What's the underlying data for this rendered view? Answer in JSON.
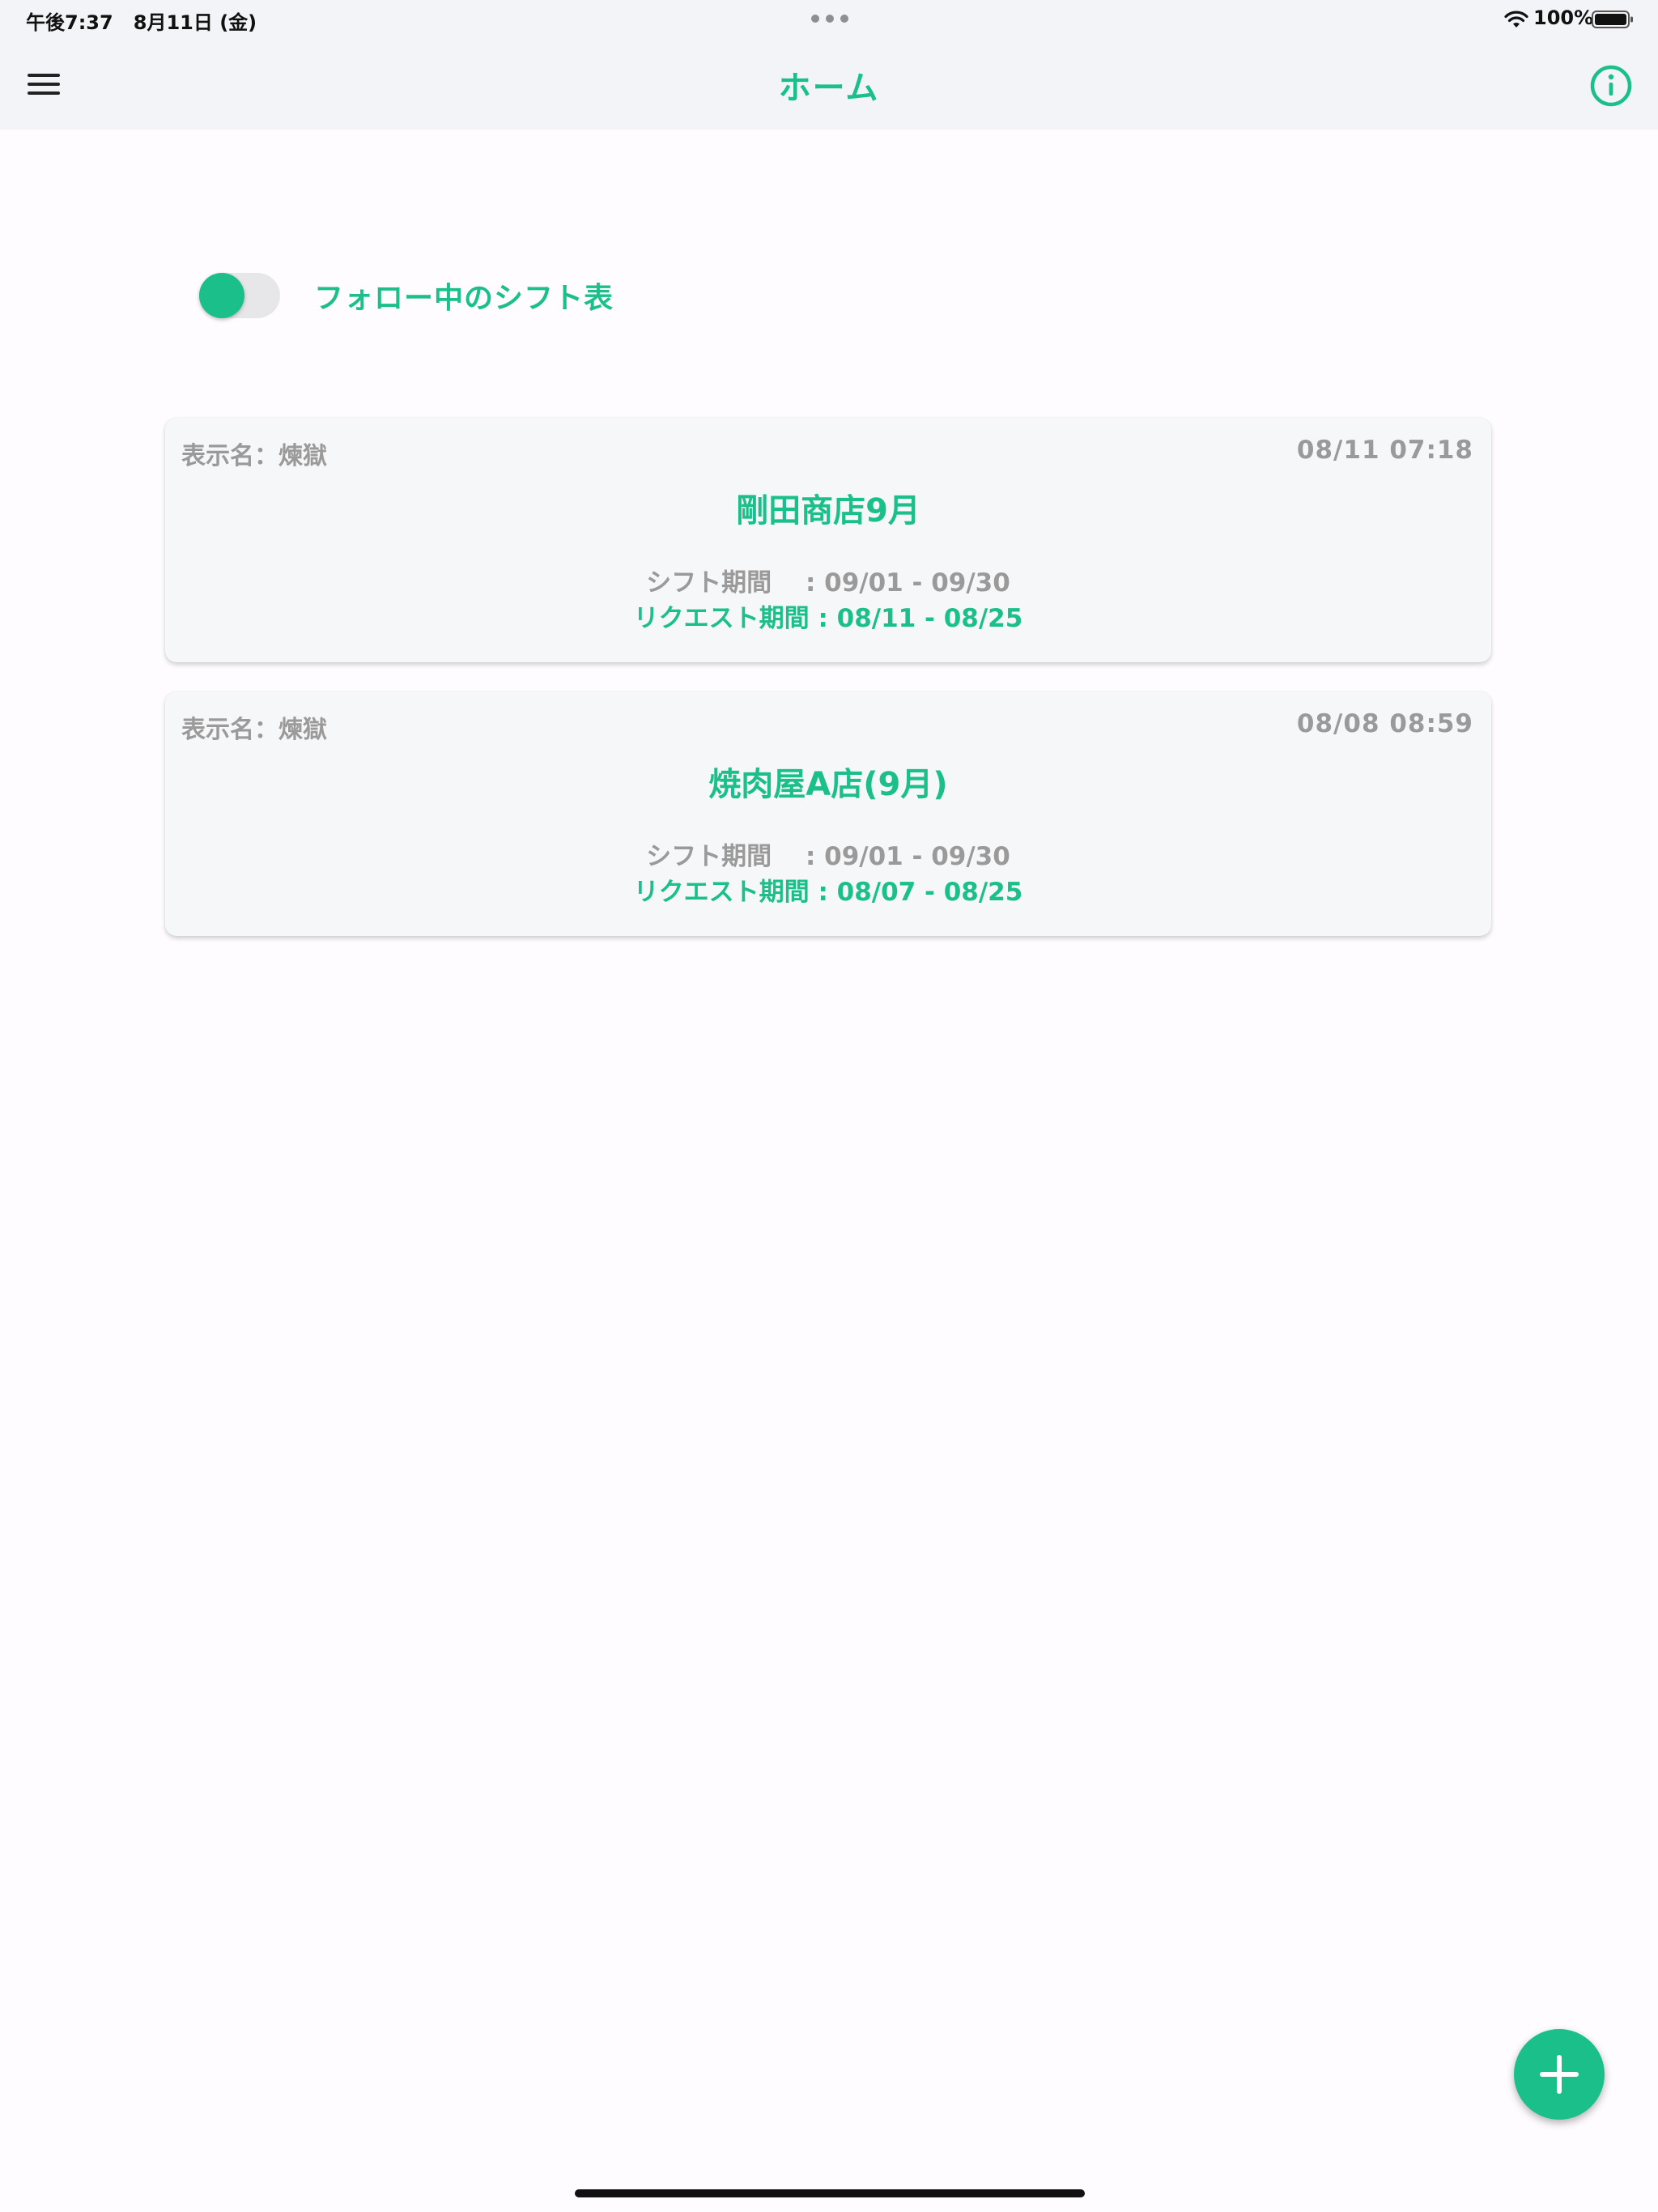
{
  "status_bar": {
    "time_date": "午後7:37   8月11日 (金)",
    "battery": "100%"
  },
  "app_bar": {
    "title": "ホーム",
    "menu_icon": "hamburger-menu-icon",
    "info_icon": "info-circle-icon"
  },
  "follow_toggle": {
    "label": "フォロー中のシフト表",
    "state": "on"
  },
  "cards": [
    {
      "display_name": "表示名：煉獄",
      "date": "08/11 07:18",
      "title": "剛田商店9月",
      "shift_period": "シフト期間　 : 09/01 - 09/30",
      "request_period": "リクエスト期間 : 08/11 - 08/25"
    },
    {
      "display_name": "表示名：煉獄",
      "date": "08/08 08:59",
      "title": "焼肉屋A店(9月)",
      "shift_period": "シフト期間　 : 09/01 - 09/30",
      "request_period": "リクエスト期間 : 08/07 - 08/25"
    }
  ],
  "fab": {
    "icon": "plus-icon"
  },
  "colors": {
    "accent": "#1bbf8a",
    "muted_text": "#9a9a9a",
    "bar_background": "#f3f4f7",
    "card_background": "#f6f7f9"
  }
}
